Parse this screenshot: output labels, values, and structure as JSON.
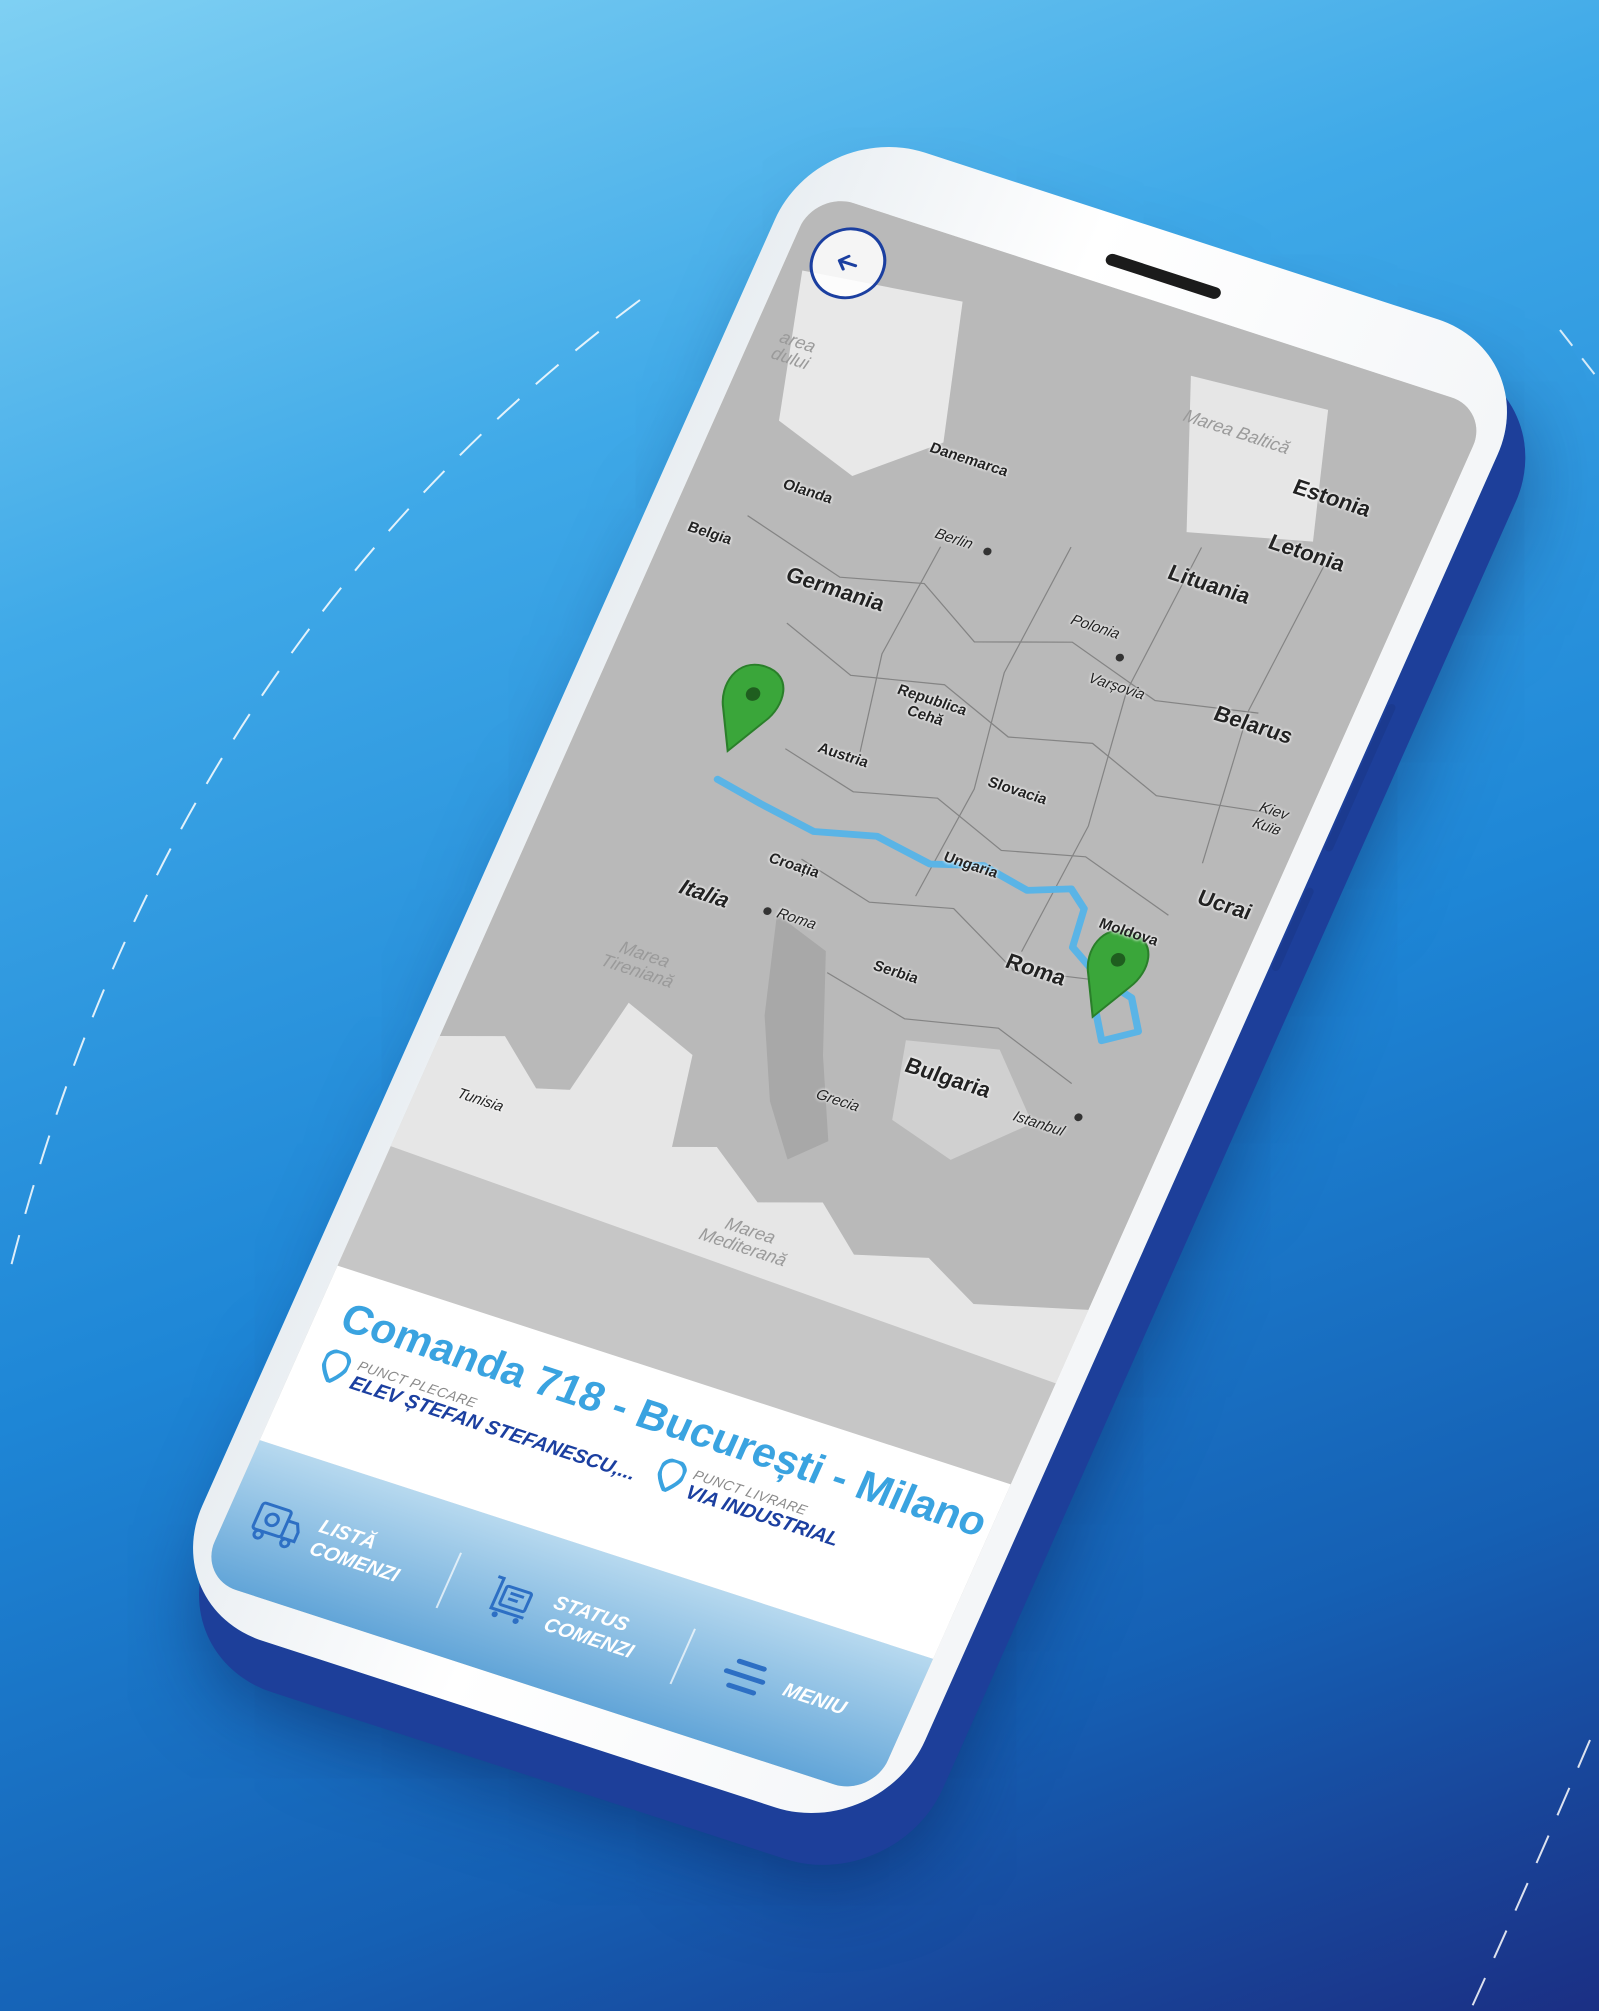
{
  "map": {
    "countries": [
      {
        "id": "estonia",
        "label": "Estonia"
      },
      {
        "id": "letonia",
        "label": "Letonia"
      },
      {
        "id": "lituania",
        "label": "Lituania"
      },
      {
        "id": "danemarca",
        "label": "Danemarca"
      },
      {
        "id": "olanda",
        "label": "Olanda"
      },
      {
        "id": "belgia",
        "label": "Belgia"
      },
      {
        "id": "germania",
        "label": "Germania"
      },
      {
        "id": "polonia",
        "label": "Polonia"
      },
      {
        "id": "belarus",
        "label": "Belarus"
      },
      {
        "id": "republica-ceha",
        "label": "Republica Cehă"
      },
      {
        "id": "austria",
        "label": "Austria"
      },
      {
        "id": "slovacia",
        "label": "Slovacia"
      },
      {
        "id": "ungaria",
        "label": "Ungaria"
      },
      {
        "id": "ucraina",
        "label": "Ucrai"
      },
      {
        "id": "moldova",
        "label": "Moldova"
      },
      {
        "id": "croatia",
        "label": "Croația"
      },
      {
        "id": "romania",
        "label": "Roma"
      },
      {
        "id": "italia",
        "label": "Italia"
      },
      {
        "id": "serbia",
        "label": "Serbia"
      },
      {
        "id": "bulgaria",
        "label": "Bulgaria"
      },
      {
        "id": "grecia",
        "label": "Grecia"
      },
      {
        "id": "tunisia",
        "label": "Tunisia"
      }
    ],
    "cities": [
      {
        "id": "berlin",
        "label": "Berlin"
      },
      {
        "id": "varsovia",
        "label": "Varșovia"
      },
      {
        "id": "kiev",
        "label": "Kiev Київ"
      },
      {
        "id": "roma",
        "label": "Roma"
      },
      {
        "id": "istanbul",
        "label": "Istanbul"
      }
    ],
    "seas": [
      {
        "id": "marea-baltica",
        "label": "Marea Baltică"
      },
      {
        "id": "marea-nordului",
        "label": "area dului"
      },
      {
        "id": "marea-tireniana",
        "label": "Marea Tireniană"
      },
      {
        "id": "marea-mediterana",
        "label": "Marea Mediterană"
      }
    ],
    "route_color": "#5ab4e6",
    "marker_color": "#3aa63a"
  },
  "order": {
    "title": "Comanda 718 - București - Milano",
    "pickup_label": "PUNCT PLECARE",
    "pickup_value": "ELEV ȘTEFAN STEFANESCU,...",
    "delivery_label": "PUNCT LIVRARE",
    "delivery_value": "VIA INDUSTRIAL"
  },
  "nav": {
    "items": [
      {
        "label": "LISTĂ COMENZI",
        "icon": "truck-list-icon"
      },
      {
        "label": "STATUS COMENZI",
        "icon": "cart-status-icon"
      },
      {
        "label": "MENIU",
        "icon": "menu-icon"
      }
    ]
  },
  "colors": {
    "accent": "#3aa3e0",
    "brand_dark": "#1b3fa0",
    "nav_bg": "#62a5d8"
  }
}
